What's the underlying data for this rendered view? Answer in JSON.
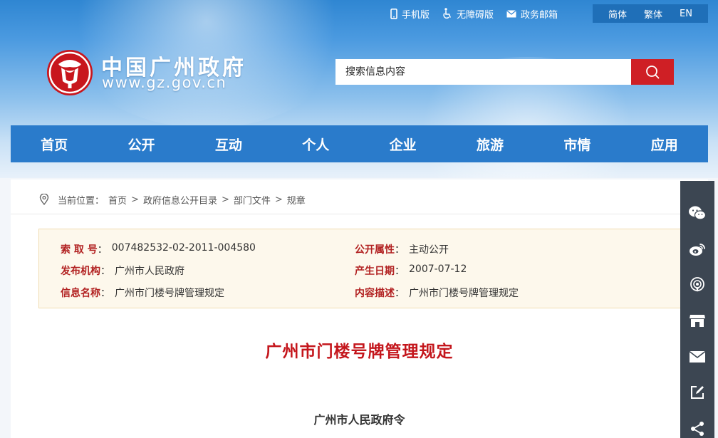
{
  "topbar": {
    "items": [
      {
        "label": "手机版",
        "icon": "mobile-icon"
      },
      {
        "label": "无障碍版",
        "icon": "accessibility-icon"
      },
      {
        "label": "政务邮箱",
        "icon": "mail-icon"
      }
    ],
    "languages": [
      "简体",
      "繁体",
      "EN"
    ]
  },
  "site": {
    "name": "中国广州政府",
    "url": "www.gz.gov.cn"
  },
  "search": {
    "placeholder": "搜索信息内容"
  },
  "nav": {
    "items": [
      "首页",
      "公开",
      "互动",
      "个人",
      "企业",
      "旅游",
      "市情",
      "应用"
    ]
  },
  "breadcrumb": {
    "prefix": "当前位置：",
    "items": [
      "首页",
      "政府信息公开目录",
      "部门文件",
      "规章"
    ],
    "separator": ">"
  },
  "meta": {
    "index_label": "索 取 号",
    "index_value": "007482532-02-2011-004580",
    "attr_label": "公开属性",
    "attr_value": "主动公开",
    "org_label": "发布机构",
    "org_value": "广州市人民政府",
    "date_label": "产生日期",
    "date_value": "2007-07-12",
    "name_label": "信息名称",
    "name_value": "广州市门楼号牌管理规定",
    "desc_label": "内容描述",
    "desc_value": "广州市门楼号牌管理规定"
  },
  "document": {
    "title": "广州市门楼号牌管理规定",
    "subtitle": "广州市人民政府令"
  },
  "share_rail": {
    "icons": [
      "wechat-icon",
      "weibo-icon",
      "podcast-icon",
      "store-icon",
      "mail-icon",
      "edit-icon",
      "share-icon"
    ]
  },
  "colors": {
    "nav_blue": "#2a7bcb",
    "search_red": "#cf1f25",
    "title_red": "#c4161c",
    "label_red": "#b22222",
    "meta_bg": "#fdf8ec",
    "rail_bg": "#3c4652"
  }
}
